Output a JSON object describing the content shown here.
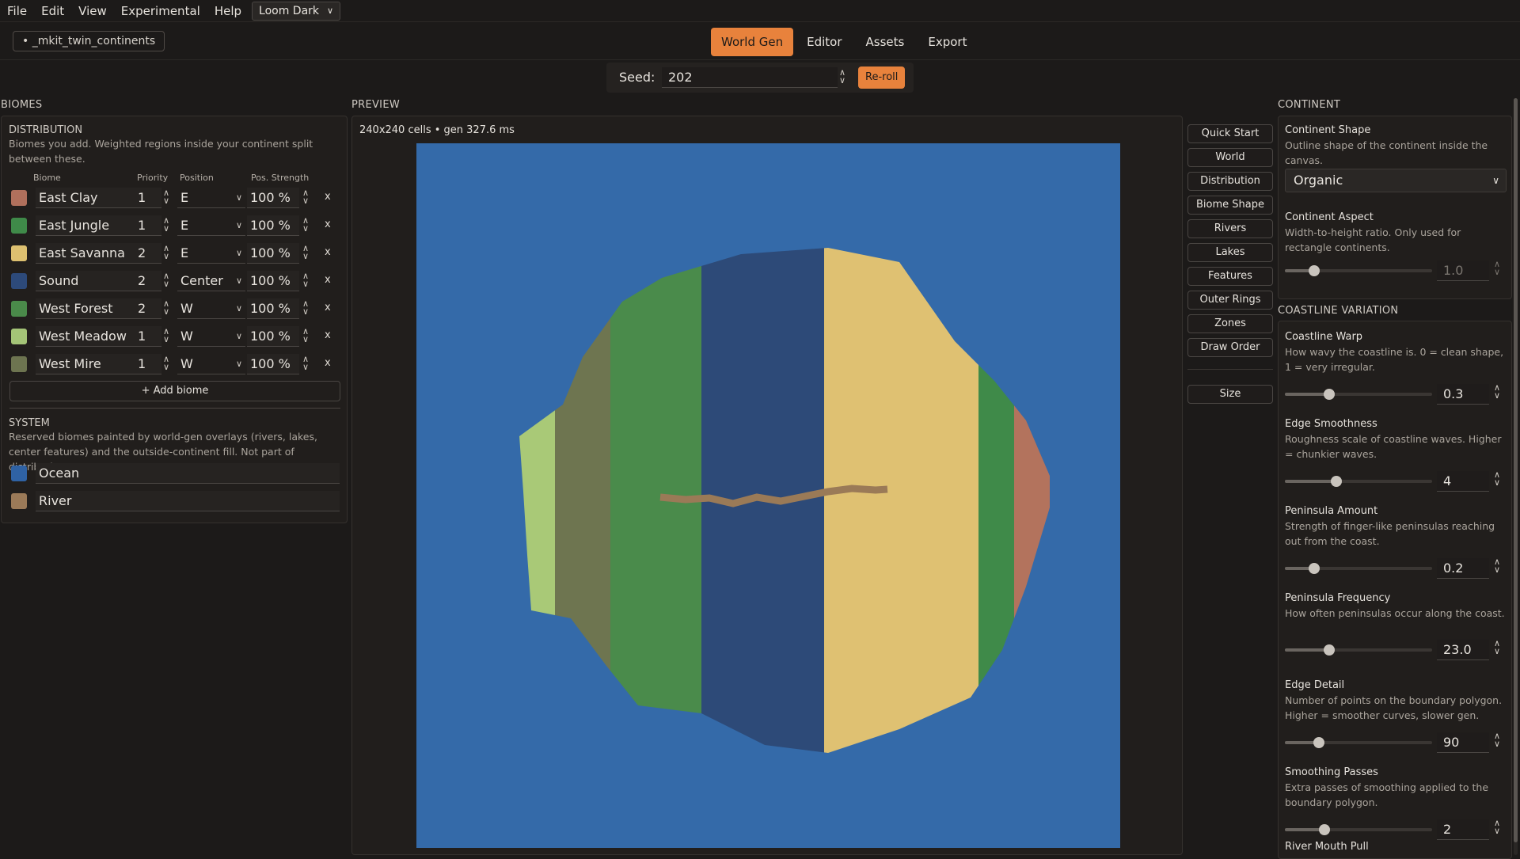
{
  "menu": {
    "items": [
      "File",
      "Edit",
      "View",
      "Experimental",
      "Help"
    ],
    "theme": "Loom Dark"
  },
  "project": {
    "name": "• _mkit_twin_continents"
  },
  "tabs": [
    "World Gen",
    "Editor",
    "Assets",
    "Export"
  ],
  "seed": {
    "label": "Seed:",
    "value": "202",
    "reroll": "Re-roll"
  },
  "biomes": {
    "section": "BIOMES",
    "distribution_title": "DISTRIBUTION",
    "distribution_desc": "Biomes you add. Weighted regions inside your continent split between these.",
    "columns": {
      "biome": "Biome",
      "priority": "Priority",
      "position": "Position",
      "strength": "Pos. Strength"
    },
    "rows": [
      {
        "name": "East Clay",
        "priority": "1",
        "position": "E",
        "strength": "100 %",
        "color": "#b0705c"
      },
      {
        "name": "East Jungle",
        "priority": "1",
        "position": "E",
        "strength": "100 %",
        "color": "#3f8a49"
      },
      {
        "name": "East Savanna",
        "priority": "2",
        "position": "E",
        "strength": "100 %",
        "color": "#ddc070"
      },
      {
        "name": "Sound",
        "priority": "2",
        "position": "Center",
        "strength": "100 %",
        "color": "#2d4a7a"
      },
      {
        "name": "West Forest",
        "priority": "2",
        "position": "W",
        "strength": "100 %",
        "color": "#4a8a4a"
      },
      {
        "name": "West Meadow",
        "priority": "1",
        "position": "W",
        "strength": "100 %",
        "color": "#a4c477"
      },
      {
        "name": "West Mire",
        "priority": "1",
        "position": "W",
        "strength": "100 %",
        "color": "#6d7450"
      }
    ],
    "add_label": "+ Add biome",
    "remove_label": "x",
    "system_title": "SYSTEM",
    "system_desc": "Reserved biomes painted by world-gen overlays (rivers, lakes, center features) and the outside-continent fill. Not part of distribution.",
    "system_rows": [
      {
        "name": "Ocean",
        "color": "#2f62a4"
      },
      {
        "name": "River",
        "color": "#9b7a58"
      }
    ]
  },
  "preview": {
    "section": "PREVIEW",
    "info": "240x240 cells • gen 327.6 ms",
    "colors": {
      "ocean": "#346aa9",
      "meadow": "#a9c977",
      "mire": "#6e7550",
      "forest": "#4a8b4b",
      "sound": "#2d4a78",
      "savanna": "#dfc172",
      "jungle": "#3f8a49",
      "clay": "#b3735d",
      "river": "#9a7a57"
    }
  },
  "side_buttons": [
    "Quick Start",
    "World",
    "Distribution",
    "Biome Shape",
    "Rivers",
    "Lakes",
    "Features",
    "Outer Rings",
    "Zones",
    "Draw Order"
  ],
  "size_button": "Size",
  "continent": {
    "section": "CONTINENT",
    "shape_label": "Continent Shape",
    "shape_desc": "Outline shape of the continent inside the canvas.",
    "shape_value": "Organic",
    "aspect_label": "Continent Aspect",
    "aspect_desc": "Width-to-height ratio. Only used for rectangle continents.",
    "aspect_value": "1.0",
    "aspect_level": 0.2
  },
  "coastline": {
    "section": "COASTLINE VARIATION",
    "fields": [
      {
        "label": "Coastline Warp",
        "desc": "How wavy the coastline is. 0 = clean shape, 1 = very irregular.",
        "value": "0.3",
        "level": 0.3
      },
      {
        "label": "Edge Smoothness",
        "desc": "Roughness scale of coastline waves. Higher = chunkier waves.",
        "value": "4",
        "level": 0.35
      },
      {
        "label": "Peninsula Amount",
        "desc": "Strength of finger-like peninsulas reaching out from the coast.",
        "value": "0.2",
        "level": 0.2
      },
      {
        "label": "Peninsula Frequency",
        "desc": "How often peninsulas occur along the coast.",
        "value": "23.0",
        "level": 0.3
      },
      {
        "label": "Edge Detail",
        "desc": "Number of points on the boundary polygon. Higher = smoother curves, slower gen.",
        "value": "90",
        "level": 0.23
      },
      {
        "label": "Smoothing Passes",
        "desc": "Extra passes of smoothing applied to the boundary polygon.",
        "value": "2",
        "level": 0.27
      }
    ],
    "next_label": "River Mouth Pull"
  }
}
